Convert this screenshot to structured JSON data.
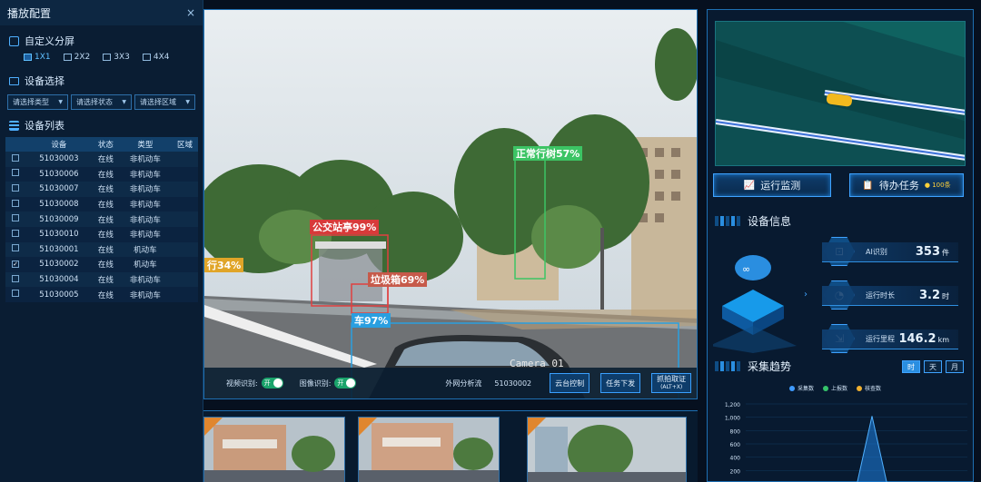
{
  "left": {
    "title": "播放配置",
    "close": "×",
    "split_title": "自定义分屏",
    "grid_options": [
      "1X1",
      "2X2",
      "3X3",
      "4X4"
    ],
    "device_select_title": "设备选择",
    "selects": [
      "请选择类型",
      "请选择状态",
      "请选择区域"
    ],
    "device_list_title": "设备列表",
    "columns": [
      "设备",
      "状态",
      "类型",
      "区域"
    ],
    "rows": [
      {
        "id": "51030003",
        "status": "在线",
        "type": "非机动车",
        "checked": false
      },
      {
        "id": "51030006",
        "status": "在线",
        "type": "非机动车",
        "checked": false
      },
      {
        "id": "51030007",
        "status": "在线",
        "type": "非机动车",
        "checked": false
      },
      {
        "id": "51030008",
        "status": "在线",
        "type": "非机动车",
        "checked": false
      },
      {
        "id": "51030009",
        "status": "在线",
        "type": "非机动车",
        "checked": false
      },
      {
        "id": "51030010",
        "status": "在线",
        "type": "非机动车",
        "checked": false
      },
      {
        "id": "51030001",
        "status": "在线",
        "type": "机动车",
        "checked": false
      },
      {
        "id": "51030002",
        "status": "在线",
        "type": "机动车",
        "checked": true
      },
      {
        "id": "51030004",
        "status": "在线",
        "type": "非机动车",
        "checked": false
      },
      {
        "id": "51030005",
        "status": "在线",
        "type": "非机动车",
        "checked": false
      }
    ]
  },
  "video": {
    "detections": [
      "正常行树57%",
      "公交站亭99%",
      "垃圾箱69%",
      "车97%",
      "行34%"
    ],
    "camera_label": "Camera 01",
    "video_rec_label": "视频识别:",
    "image_rec_label": "图像识别:",
    "toggle_on": "开",
    "stream_label": "外网分析流",
    "stream_id": "51030002",
    "btn_ptz": "云台控制",
    "btn_task": "任务下发",
    "btn_capture": "抓拍取证",
    "btn_capture_hint": "(ALT+X)"
  },
  "right": {
    "btn_monitor": "运行监测",
    "btn_todo": "待办任务",
    "todo_count": "100条",
    "device_info_title": "设备信息",
    "stats": [
      {
        "label": "AI识别",
        "value": "353",
        "unit": "件"
      },
      {
        "label": "运行时长",
        "value": "3.2",
        "unit": "时"
      },
      {
        "label": "运行里程",
        "value": "146.2",
        "unit": "km"
      }
    ],
    "trend_title": "采集趋势",
    "tabs": [
      "时",
      "天",
      "月"
    ],
    "legend": [
      "采集数",
      "上报数",
      "核查数"
    ],
    "legend_colors": [
      "#3f9bff",
      "#35c46a",
      "#f0b030"
    ]
  },
  "chart_data": {
    "type": "area",
    "series": [
      {
        "name": "采集数",
        "values": [
          0,
          0,
          0,
          0,
          0,
          0,
          0,
          1000,
          0,
          0,
          0,
          0,
          0
        ]
      }
    ],
    "x": [
      "",
      "",
      "",
      "",
      "",
      "",
      "",
      "",
      "",
      "",
      "",
      "",
      ""
    ],
    "yticks": [
      "1,200",
      "1,000",
      "800",
      "600",
      "400",
      "200"
    ],
    "ylim": [
      0,
      1200
    ]
  }
}
